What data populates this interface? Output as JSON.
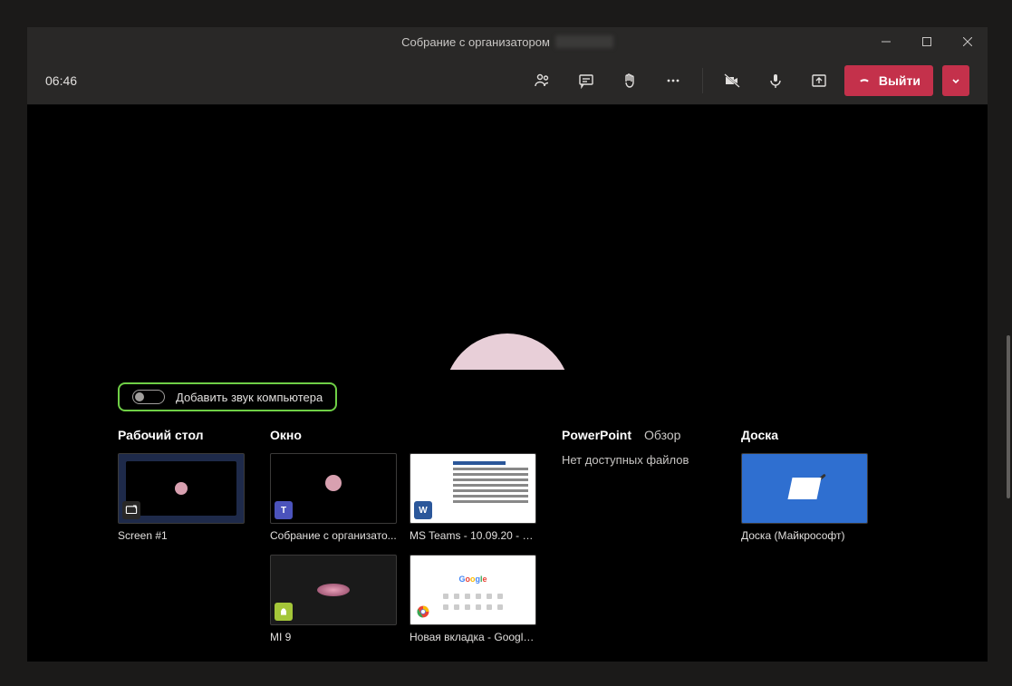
{
  "titlebar": {
    "title_prefix": "Собрание с организатором"
  },
  "toolbar": {
    "timer": "06:46",
    "leave_label": "Выйти"
  },
  "share": {
    "audio_toggle_label": "Добавить звук компьютера",
    "categories": {
      "desktop": {
        "title": "Рабочий стол",
        "thumb_label": "Screen #1"
      },
      "window": {
        "title": "Окно",
        "items": [
          "Собрание с организато...",
          "MS Teams - 10.09.20 - 1...",
          "MI 9",
          "Новая вкладка - Google..."
        ]
      },
      "powerpoint": {
        "title": "PowerPoint",
        "subtitle": "Обзор",
        "no_files": "Нет доступных файлов"
      },
      "whiteboard": {
        "title": "Доска",
        "item": "Доска (Майкрософт)"
      }
    }
  }
}
